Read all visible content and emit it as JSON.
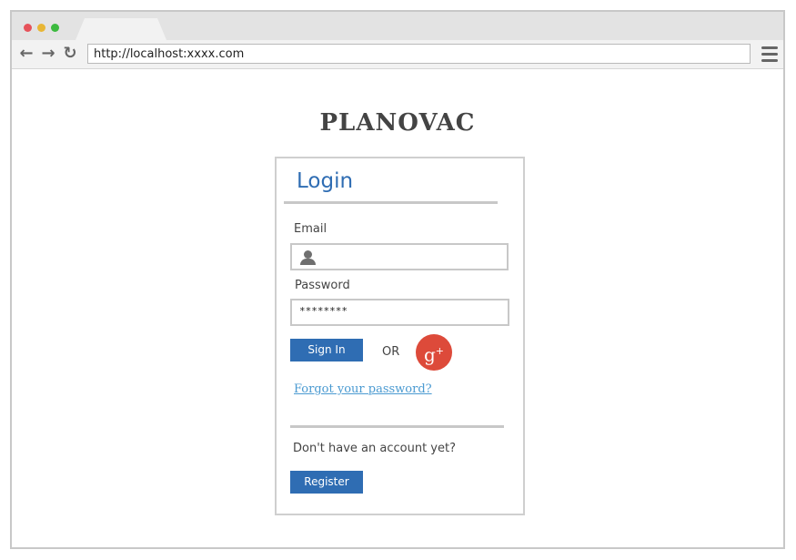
{
  "browser": {
    "url": "http://localhost:xxxx.com",
    "back_icon": "arrow-left-icon",
    "forward_icon": "arrow-right-icon",
    "reload_icon": "reload-icon",
    "menu_icon": "hamburger-menu-icon",
    "traffic_light_colors": [
      "#e6525a",
      "#e8b635",
      "#3cba3f"
    ]
  },
  "brand": {
    "title": "PLANOVAC"
  },
  "login": {
    "title": "Login",
    "email_label": "Email",
    "email_value": "",
    "user_icon": "user-icon",
    "password_label": "Password",
    "password_value": "********",
    "signin_label": "Sign In",
    "or_text": "OR",
    "google_plus_icon": "google-plus-icon",
    "forgot_link": "Forgot your password?",
    "no_account_text": "Don't have an account yet?",
    "register_label": "Register"
  },
  "colors": {
    "accent": "#2f6db3",
    "link": "#4a9ad1",
    "google_plus": "#dd4a3a"
  }
}
